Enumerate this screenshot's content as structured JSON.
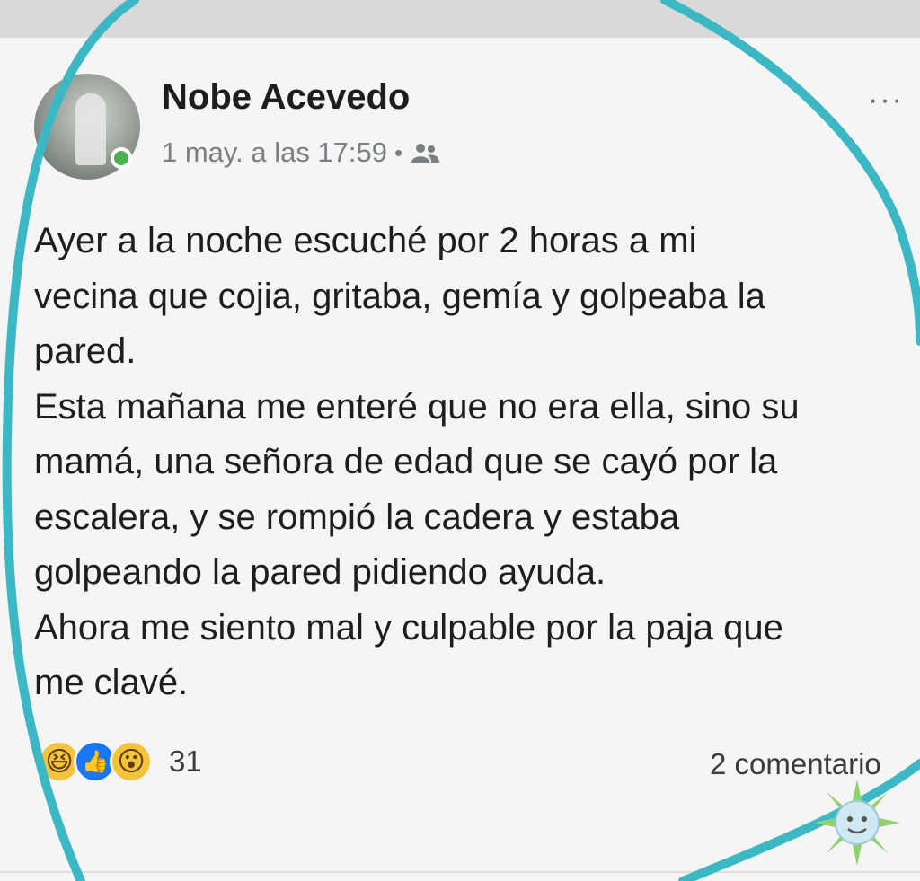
{
  "post": {
    "author": "Nobe Acevedo",
    "timestamp": "1 may. a las 17:59",
    "separator": "•",
    "audience_icon": "friends-icon",
    "more_label": "···",
    "body_lines": [
      "Ayer a la noche escuché por 2 horas a mi",
      "vecina que cojia, gritaba, gemía y golpeaba la",
      "pared.",
      "Esta mañana me enteré que no era ella, sino su",
      "mamá, una señora de edad que se cayó por la",
      "escalera, y se rompió la cadera y estaba",
      "golpeando la pared pidiendo ayuda.",
      "Ahora me siento mal y culpable por la paja que",
      "me clavé."
    ],
    "reactions": {
      "icons": [
        "haha-reaction-icon",
        "like-reaction-icon",
        "wow-reaction-icon"
      ],
      "count": "31"
    },
    "comments_label": "2 comentario"
  },
  "colors": {
    "background": "#f4f5f4",
    "text": "#1c1e21",
    "meta": "#7a7f84",
    "online": "#4caf50",
    "overlay_circle": "#3cb8c4",
    "like_blue": "#1877f2",
    "reaction_yellow": "#f5c33b"
  }
}
